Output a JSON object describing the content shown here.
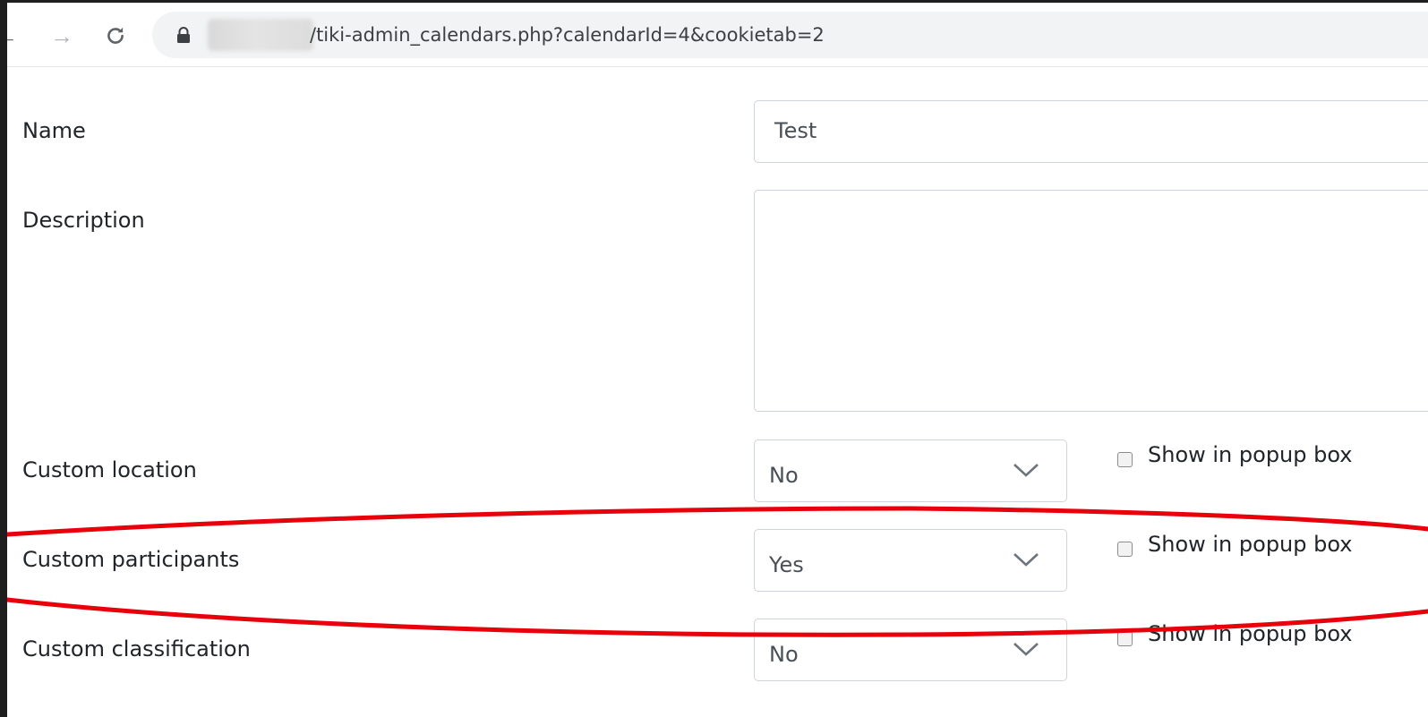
{
  "browser": {
    "url": "/tiki-admin_calendars.php?calendarId=4&cookietab=2"
  },
  "form": {
    "name": {
      "label": "Name",
      "value": "Test"
    },
    "description": {
      "label": "Description",
      "value": ""
    },
    "custom_location": {
      "label": "Custom location",
      "selected": "No",
      "checkbox_label": "Show in popup box",
      "checked": false
    },
    "custom_participants": {
      "label": "Custom participants",
      "selected": "Yes",
      "checkbox_label": "Show in popup box",
      "checked": false
    },
    "custom_classification": {
      "label": "Custom classification",
      "selected": "No",
      "checkbox_label": "Show in popup box",
      "checked": false
    }
  },
  "annotation": {
    "color": "#e8000b",
    "target": "custom_participants"
  },
  "icons": [
    "back-arrow-icon",
    "forward-arrow-icon",
    "reload-icon",
    "lock-icon",
    "chevron-down-icon"
  ]
}
